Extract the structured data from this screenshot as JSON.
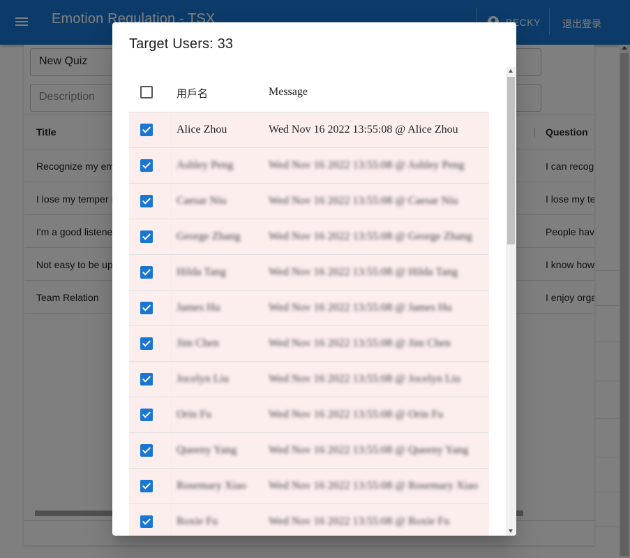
{
  "app": {
    "title": "Emotion Regulation - TSX",
    "user": "BECKY",
    "logout": "退出登录"
  },
  "quiz_form": {
    "name_value": "New Quiz",
    "description_placeholder": "Description"
  },
  "quiz_table": {
    "headers": {
      "title": "Title",
      "question": "Question"
    },
    "rows": [
      {
        "title": "Recognize my em s",
        "question": "I can recog"
      },
      {
        "title": "I lose my temper I feel frustrated.",
        "question": "I lose my te"
      },
      {
        "title": "I'm a good listene",
        "question": "People hav"
      },
      {
        "title": "Not easy to be up",
        "question": "I know how"
      },
      {
        "title": "Team Relation",
        "question": "I enjoy orga"
      }
    ]
  },
  "dialog": {
    "title": "Target Users: 33",
    "headers": {
      "username": "用戶名",
      "message": "Message"
    },
    "rows": [
      {
        "name": "Alice Zhou",
        "message": "Wed Nov 16 2022 13:55:08 @ Alice Zhou",
        "checked": true,
        "blurred": false
      },
      {
        "name": "Ashley Peng",
        "message": "Wed Nov 16 2022 13:55:08 @ Ashley Peng",
        "checked": true,
        "blurred": true
      },
      {
        "name": "Caesar Niu",
        "message": "Wed Nov 16 2022 13:55:08 @ Caesar Niu",
        "checked": true,
        "blurred": true
      },
      {
        "name": "George Zhang",
        "message": "Wed Nov 16 2022 13:55:08 @ George Zhang",
        "checked": true,
        "blurred": true
      },
      {
        "name": "Hilda Tang",
        "message": "Wed Nov 16 2022 13:55:08 @ Hilda Tang",
        "checked": true,
        "blurred": true
      },
      {
        "name": "James Hu",
        "message": "Wed Nov 16 2022 13:55:08 @ James Hu",
        "checked": true,
        "blurred": true
      },
      {
        "name": "Jim Chen",
        "message": "Wed Nov 16 2022 13:55:08 @ Jim Chen",
        "checked": true,
        "blurred": true
      },
      {
        "name": "Jocelyn Liu",
        "message": "Wed Nov 16 2022 13:55:08 @ Jocelyn Liu",
        "checked": true,
        "blurred": true
      },
      {
        "name": "Orin Fu",
        "message": "Wed Nov 16 2022 13:55:08 @ Orin Fu",
        "checked": true,
        "blurred": true
      },
      {
        "name": "Queeny Yang",
        "message": "Wed Nov 16 2022 13:55:08 @ Queeny Yang",
        "checked": true,
        "blurred": true
      },
      {
        "name": "Rosemary Xiao",
        "message": "Wed Nov 16 2022 13:55:08 @ Rosemary Xiao",
        "checked": true,
        "blurred": true
      },
      {
        "name": "Roxie Fu",
        "message": "Wed Nov 16 2022 13:55:08 @ Roxie Fu",
        "checked": true,
        "blurred": true
      }
    ]
  },
  "colors": {
    "primary": "#1976d2",
    "selected_row": "#fdeeee",
    "backdrop": "rgba(0,0,0,0.5)"
  }
}
